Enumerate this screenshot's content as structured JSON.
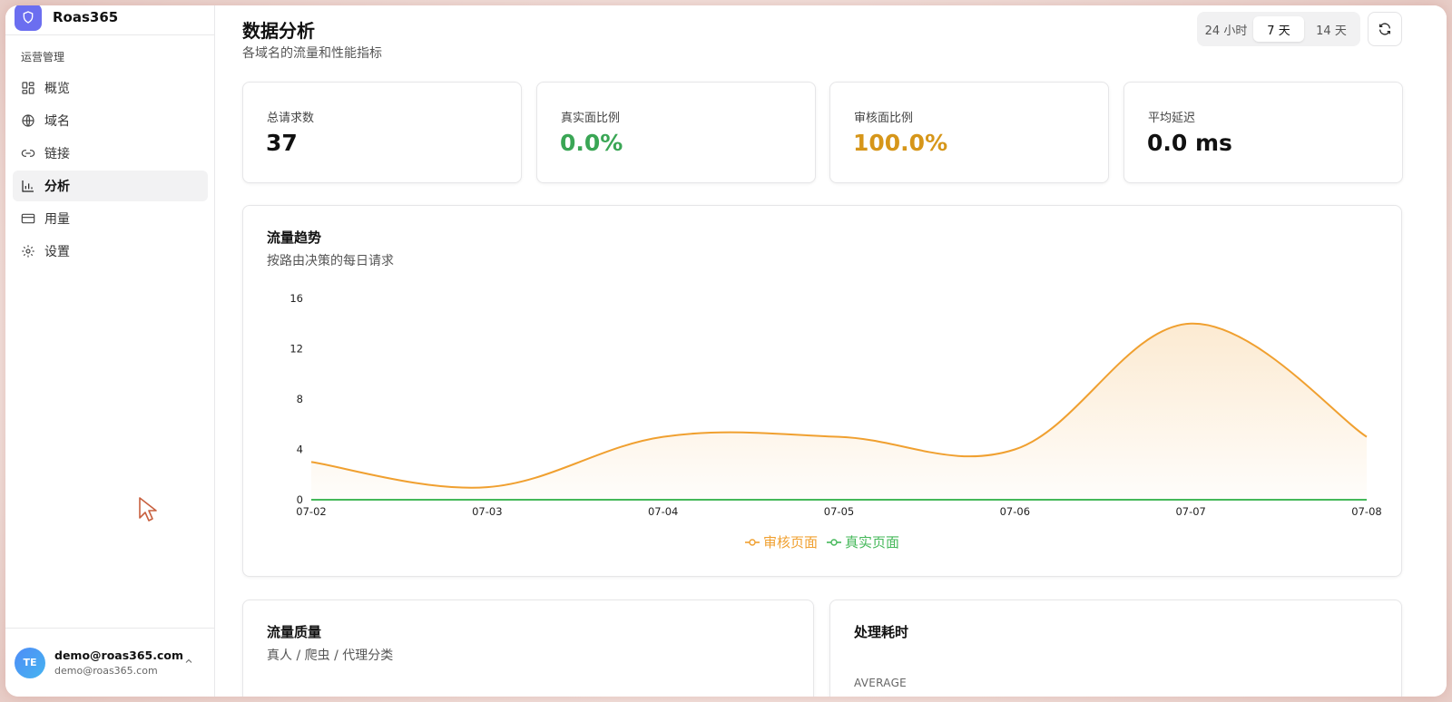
{
  "brand": {
    "name": "Roas365"
  },
  "sidebar": {
    "group_label": "运营管理",
    "items": [
      {
        "label": "概览",
        "icon": "dashboard-icon"
      },
      {
        "label": "域名",
        "icon": "globe-icon"
      },
      {
        "label": "链接",
        "icon": "link-icon"
      },
      {
        "label": "分析",
        "icon": "bar-chart-icon",
        "active": true
      },
      {
        "label": "用量",
        "icon": "credit-card-icon"
      },
      {
        "label": "设置",
        "icon": "gear-icon"
      }
    ]
  },
  "user": {
    "initials": "TE",
    "name": "demo@roas365.com",
    "email": "demo@roas365.com"
  },
  "header": {
    "title": "数据分析",
    "subtitle": "各域名的流量和性能指标",
    "range_tabs": [
      "24 小时",
      "7 天",
      "14 天"
    ],
    "active_range": "7 天"
  },
  "stats": [
    {
      "label": "总请求数",
      "value": "37",
      "color": "#111111"
    },
    {
      "label": "真实面比例",
      "value": "0.0%",
      "color": "#3aa655"
    },
    {
      "label": "审核面比例",
      "value": "100.0%",
      "color": "#d6961a"
    },
    {
      "label": "平均延迟",
      "value": "0.0 ms",
      "color": "#111111"
    }
  ],
  "trend_card": {
    "title": "流量趋势",
    "subtitle": "按路由决策的每日请求"
  },
  "quality_card": {
    "title": "流量质量",
    "subtitle": "真人 / 爬虫 / 代理分类"
  },
  "latency_card": {
    "title": "处理耗时",
    "caption": "AVERAGE"
  },
  "colors": {
    "review": "#f0a030",
    "real": "#45b85a",
    "accent": "#6b6ef0"
  },
  "chart_data": {
    "type": "area",
    "categories": [
      "07-02",
      "07-03",
      "07-04",
      "07-05",
      "07-06",
      "07-07",
      "07-08"
    ],
    "yticks": [
      0,
      4,
      8,
      12,
      16
    ],
    "ylim": [
      0,
      16
    ],
    "series": [
      {
        "name": "审核页面",
        "values": [
          3,
          1,
          5,
          5,
          4,
          14,
          5
        ],
        "color": "#f0a030"
      },
      {
        "name": "真实页面",
        "values": [
          0,
          0,
          0,
          0,
          0,
          0,
          0
        ],
        "color": "#45b85a"
      }
    ],
    "legend_position": "bottom"
  }
}
